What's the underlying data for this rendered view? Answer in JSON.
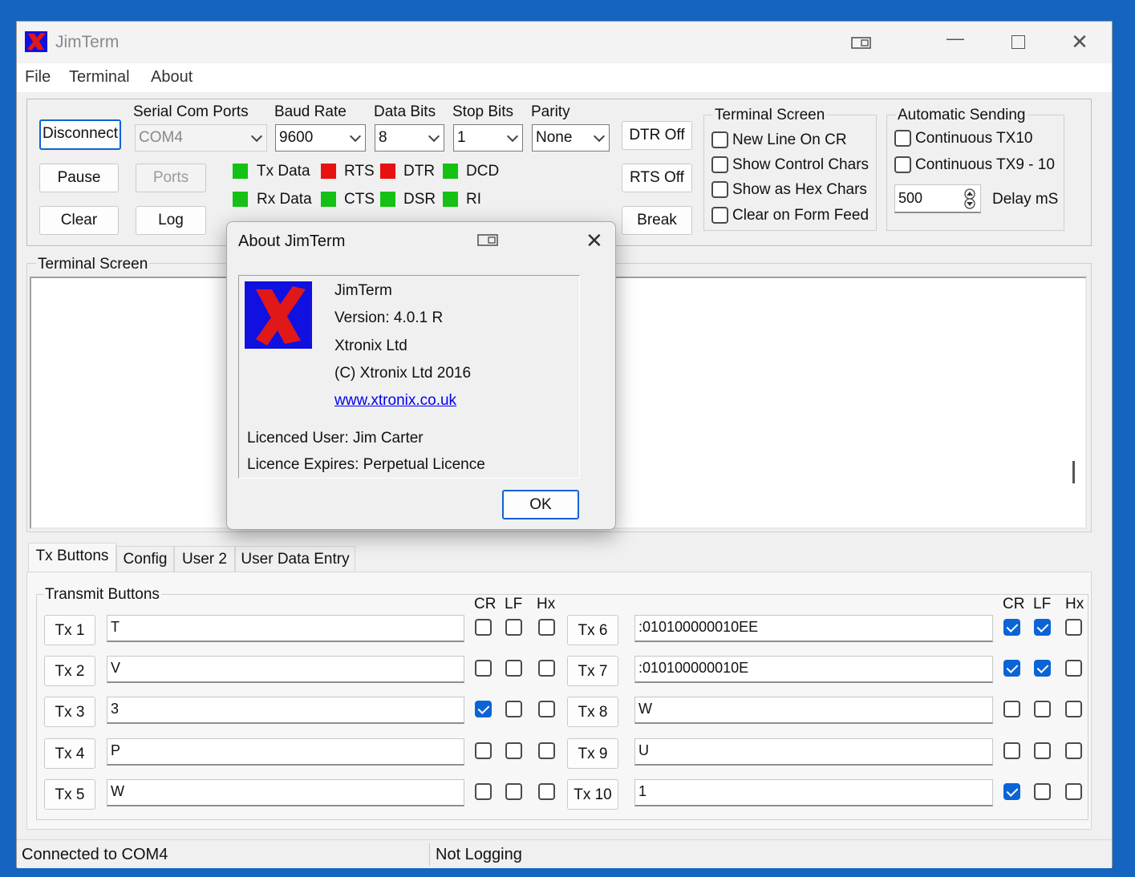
{
  "app": {
    "title": "JimTerm"
  },
  "menu": [
    "File",
    "Terminal",
    "About"
  ],
  "controls": {
    "disconnect": "Disconnect",
    "pause": "Pause",
    "clear": "Clear",
    "ports": "Ports",
    "log": "Log",
    "dtr_off": "DTR Off",
    "rts_off": "RTS Off",
    "break": "Break"
  },
  "serial": {
    "com_label": "Serial Com Ports",
    "com_value": "COM4",
    "baud_label": "Baud Rate",
    "baud_value": "9600",
    "data_label": "Data Bits",
    "data_value": "8",
    "stop_label": "Stop Bits",
    "stop_value": "1",
    "parity_label": "Parity",
    "parity_value": "None"
  },
  "indicators": [
    {
      "label": "Tx Data",
      "color": "#16c116"
    },
    {
      "label": "RTS",
      "color": "#e81010"
    },
    {
      "label": "DTR",
      "color": "#e81010"
    },
    {
      "label": "DCD",
      "color": "#16c116"
    },
    {
      "label": "Rx Data",
      "color": "#16c116"
    },
    {
      "label": "CTS",
      "color": "#16c116"
    },
    {
      "label": "DSR",
      "color": "#16c116"
    },
    {
      "label": "RI",
      "color": "#16c116"
    }
  ],
  "terminal_options": {
    "title": "Terminal Screen",
    "items": [
      {
        "label": "New Line On CR",
        "checked": false
      },
      {
        "label": "Show Control Chars",
        "checked": false
      },
      {
        "label": "Show as Hex Chars",
        "checked": false
      },
      {
        "label": "Clear on Form Feed",
        "checked": false
      }
    ]
  },
  "auto_send": {
    "title": "Automatic Sending",
    "continuous_tx10": "Continuous TX10",
    "continuous_tx9": "Continuous TX9 - 10",
    "delay_value": "500",
    "delay_label": "Delay mS"
  },
  "terminal_screen_label": "Terminal Screen",
  "tabs": [
    "Tx Buttons",
    "Config",
    "User 2",
    "User Data Entry"
  ],
  "transmit": {
    "title": "Transmit Buttons",
    "headers": {
      "cr": "CR",
      "lf": "LF",
      "hx": "Hx"
    },
    "left": [
      {
        "label": "Tx 1",
        "value": "T",
        "cr": false,
        "lf": false,
        "hx": false
      },
      {
        "label": "Tx 2",
        "value": "V",
        "cr": false,
        "lf": false,
        "hx": false
      },
      {
        "label": "Tx 3",
        "value": "3",
        "cr": true,
        "lf": false,
        "hx": false
      },
      {
        "label": "Tx 4",
        "value": "P",
        "cr": false,
        "lf": false,
        "hx": false
      },
      {
        "label": "Tx 5",
        "value": "W",
        "cr": false,
        "lf": false,
        "hx": false
      }
    ],
    "right": [
      {
        "label": "Tx 6",
        "value": ":010100000010EE",
        "cr": true,
        "lf": true,
        "hx": false
      },
      {
        "label": "Tx 7",
        "value": ":010100000010E",
        "cr": true,
        "lf": true,
        "hx": false
      },
      {
        "label": "Tx 8",
        "value": "W",
        "cr": false,
        "lf": false,
        "hx": false
      },
      {
        "label": "Tx 9",
        "value": "U",
        "cr": false,
        "lf": false,
        "hx": false
      },
      {
        "label": "Tx 10",
        "value": "1",
        "cr": true,
        "lf": false,
        "hx": false
      }
    ]
  },
  "status": {
    "connection": "Connected to COM4",
    "logging": "Not Logging"
  },
  "about": {
    "title": "About JimTerm",
    "name": "JimTerm",
    "version": "Version: 4.0.1 R",
    "company": "Xtronix Ltd",
    "copyright": "(C) Xtronix Ltd 2016",
    "url": "www.xtronix.co.uk",
    "licenced_user": "Licenced User: Jim Carter",
    "licence_expires": "Licence Expires: Perpetual Licence",
    "ok": "OK"
  }
}
